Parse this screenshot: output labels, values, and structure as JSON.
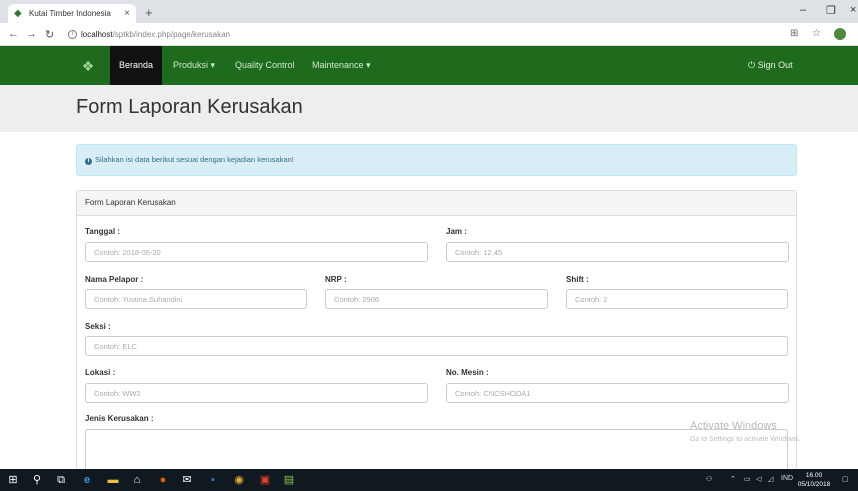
{
  "browser": {
    "tab_title": "Kutai Timber Indonesia",
    "url_host": "localhost",
    "url_path": "/sptkb/index.php/page/kerusakan"
  },
  "navbar": {
    "items": [
      {
        "label": "Beranda",
        "active": true
      },
      {
        "label": "Produksi ▾",
        "active": false
      },
      {
        "label": "Quality Control",
        "active": false
      },
      {
        "label": "Maintenance ▾",
        "active": false
      }
    ],
    "signout": "Sign Out"
  },
  "page": {
    "title": "Form Laporan Kerusakan",
    "alert": "Silahkan isi data berikut sesuai dengan kejadian kerusakan!",
    "panel_heading": "Form Laporan Kerusakan"
  },
  "form": {
    "tanggal": {
      "label": "Tanggal :",
      "placeholder": "Contoh: 2018-06-20"
    },
    "jam": {
      "label": "Jam :",
      "placeholder": "Contoh: 12.45"
    },
    "nama_pelapor": {
      "label": "Nama Pelapor :",
      "placeholder": "Contoh: Yustina Suhandini"
    },
    "nrp": {
      "label": "NRP :",
      "placeholder": "Contoh: 2906"
    },
    "shift": {
      "label": "Shift :",
      "placeholder": "Contoh: 2"
    },
    "seksi": {
      "label": "Seksi :",
      "placeholder": "Contoh: ELC"
    },
    "lokasi": {
      "label": "Lokasi :",
      "placeholder": "Contoh: WW2"
    },
    "no_mesin": {
      "label": "No. Mesin :",
      "placeholder": "Contoh: CNCSHODA1"
    },
    "jenis_kerusakan": {
      "label": "Jenis Kerusakan :"
    }
  },
  "watermark": {
    "line1": "Activate Windows",
    "line2": "Go to Settings to activate Windows."
  },
  "taskbar": {
    "lang": "IND",
    "time": "16.00",
    "date": "05/10/2018"
  },
  "colors": {
    "navbar": "#1f6b1d",
    "alert_bg": "#d9edf7",
    "alert_text": "#31708f"
  }
}
